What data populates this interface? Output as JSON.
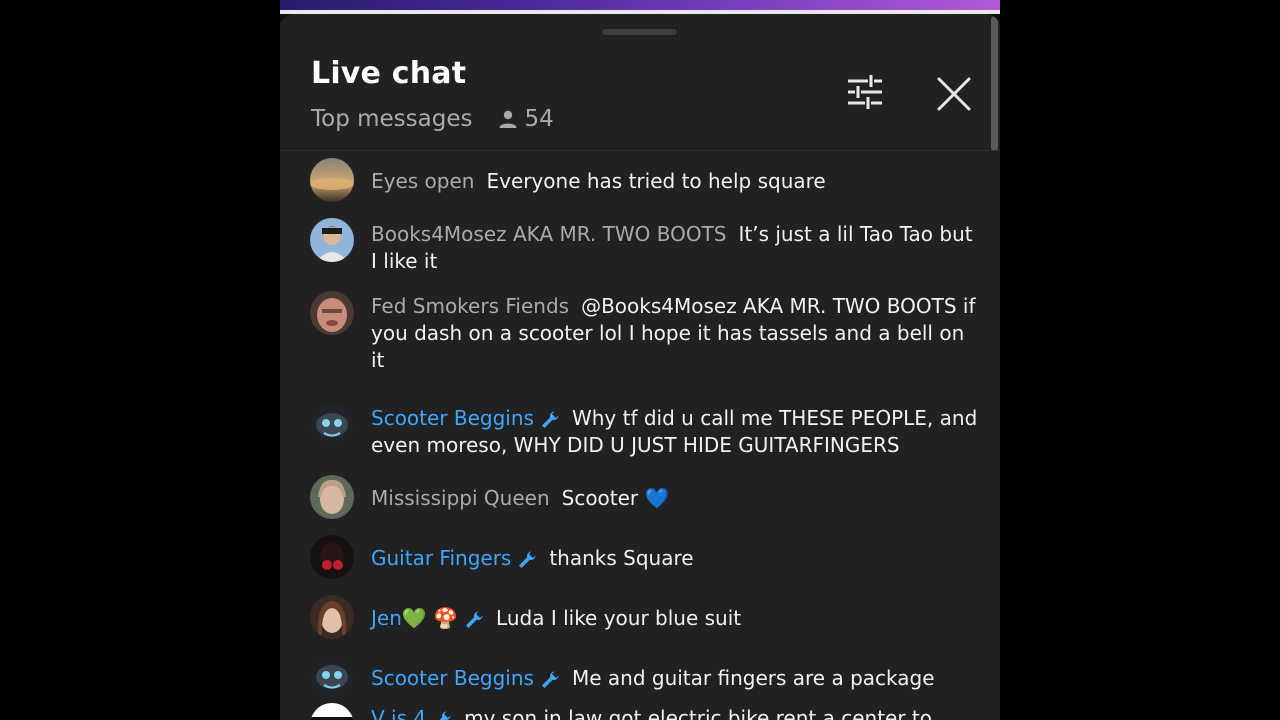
{
  "header": {
    "title": "Live chat",
    "mode_label": "Top messages",
    "viewer_count": "54"
  },
  "colors": {
    "panel_bg": "#212121",
    "moderator_name": "#3ea6ff",
    "author_name": "#aaaaaa",
    "message_text": "#f1f1f1"
  },
  "messages": [
    {
      "author": "Eyes open",
      "moderator": false,
      "text": "Everyone has tried to help square"
    },
    {
      "author": "Books4Mosez AKA MR. TWO BOOTS",
      "moderator": false,
      "text": "It’s just a lil Tao Tao but I like it"
    },
    {
      "author": "Fed Smokers Fiends",
      "moderator": false,
      "text": "@Books4Mosez AKA MR. TWO BOOTS if you dash on a scooter lol I hope it has tassels and a bell on it"
    },
    {
      "author": "Scooter Beggins",
      "moderator": true,
      "text": "Why tf did u call me THESE PEOPLE, and even moreso, WHY DID U JUST HIDE GUITARFINGERS"
    },
    {
      "author": "Mississippi Queen",
      "moderator": false,
      "text": "Scooter 💙"
    },
    {
      "author": "Guitar Fingers",
      "moderator": true,
      "text": "thanks Square"
    },
    {
      "author": "Jen💚 🍄",
      "moderator": true,
      "text": "Luda I like your blue suit"
    },
    {
      "author": "Scooter Beggins",
      "moderator": true,
      "text": "Me and guitar fingers are a package"
    },
    {
      "author": "V is 4",
      "moderator": true,
      "text": "my son in law got electric bike rent a center to"
    }
  ],
  "icons": {
    "viewers": "person-icon",
    "filter": "tune-icon",
    "close": "close-icon",
    "moderator": "wrench-icon"
  }
}
